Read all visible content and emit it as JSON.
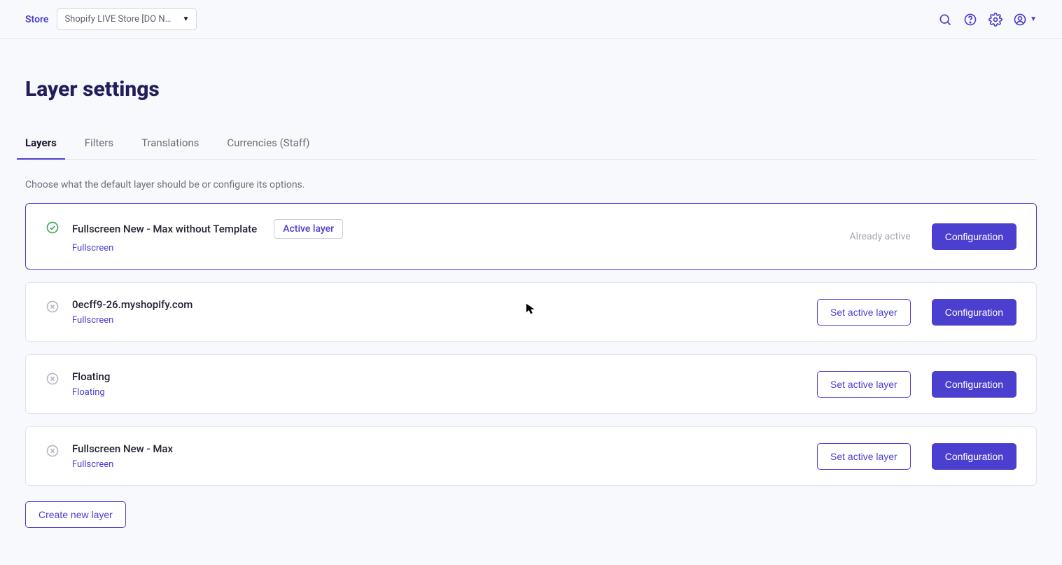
{
  "header": {
    "store_label": "Store",
    "store_selected": "Shopify LIVE Store [DO N…"
  },
  "page": {
    "title": "Layer settings",
    "subtext": "Choose what the default layer should be or configure its options."
  },
  "tabs": {
    "layers": "Layers",
    "filters": "Filters",
    "translations": "Translations",
    "currencies": "Currencies (Staff)"
  },
  "labels": {
    "active_layer_badge": "Active layer",
    "already_active": "Already active",
    "set_active": "Set active layer",
    "configuration": "Configuration",
    "create": "Create new layer"
  },
  "layers": [
    {
      "title": "Fullscreen New - Max without Template",
      "type": "Fullscreen",
      "active": true
    },
    {
      "title": "0ecff9-26.myshopify.com",
      "type": "Fullscreen",
      "active": false
    },
    {
      "title": "Floating",
      "type": "Floating",
      "active": false
    },
    {
      "title": "Fullscreen New - Max",
      "type": "Fullscreen",
      "active": false
    }
  ]
}
